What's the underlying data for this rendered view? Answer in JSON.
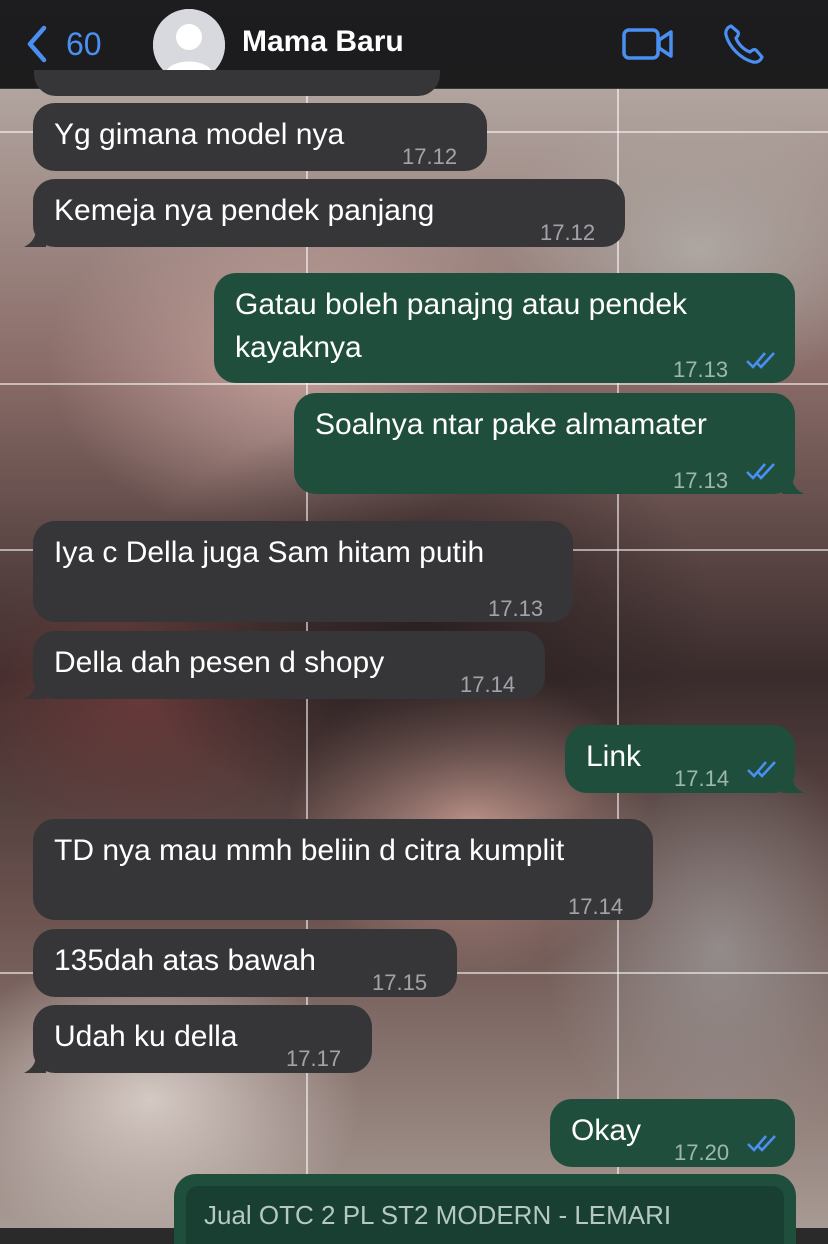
{
  "header": {
    "back_count": "60",
    "contact_name": "Mama Baru",
    "accent_color": "#4a8ff2"
  },
  "messages": [
    {
      "dir": "in",
      "text": "Yg gimana model nya",
      "time": "17.12"
    },
    {
      "dir": "in",
      "text": "Kemeja nya pendek panjang",
      "time": "17.12"
    },
    {
      "dir": "out",
      "line1": "Gatau boleh panajng atau pendek",
      "line2": "kayaknya",
      "time": "17.13",
      "status": "read"
    },
    {
      "dir": "out",
      "text": "Soalnya ntar pake almamater",
      "time": "17.13",
      "status": "read"
    },
    {
      "dir": "in",
      "text": "Iya  c Della juga Sam hitam putih",
      "time": "17.13"
    },
    {
      "dir": "in",
      "text": "Della dah pesen d shopy",
      "time": "17.14"
    },
    {
      "dir": "out",
      "text": "Link",
      "time": "17.14",
      "status": "read"
    },
    {
      "dir": "in",
      "text": "TD nya mau mmh beliin d citra kumplit",
      "time": "17.14"
    },
    {
      "dir": "in",
      "text": "135dah atas bawah",
      "time": "17.15"
    },
    {
      "dir": "in",
      "text": "Udah ku della",
      "time": "17.17"
    },
    {
      "dir": "out",
      "text": "Okay",
      "time": "17.20",
      "status": "read"
    }
  ],
  "link_preview": {
    "title": "Jual OTC 2 PL ST2 MODERN - LEMARI"
  },
  "colors": {
    "incoming_bubble": "#363638",
    "outgoing_bubble": "#1f4e3d",
    "read_ticks": "#4a8ff2"
  }
}
